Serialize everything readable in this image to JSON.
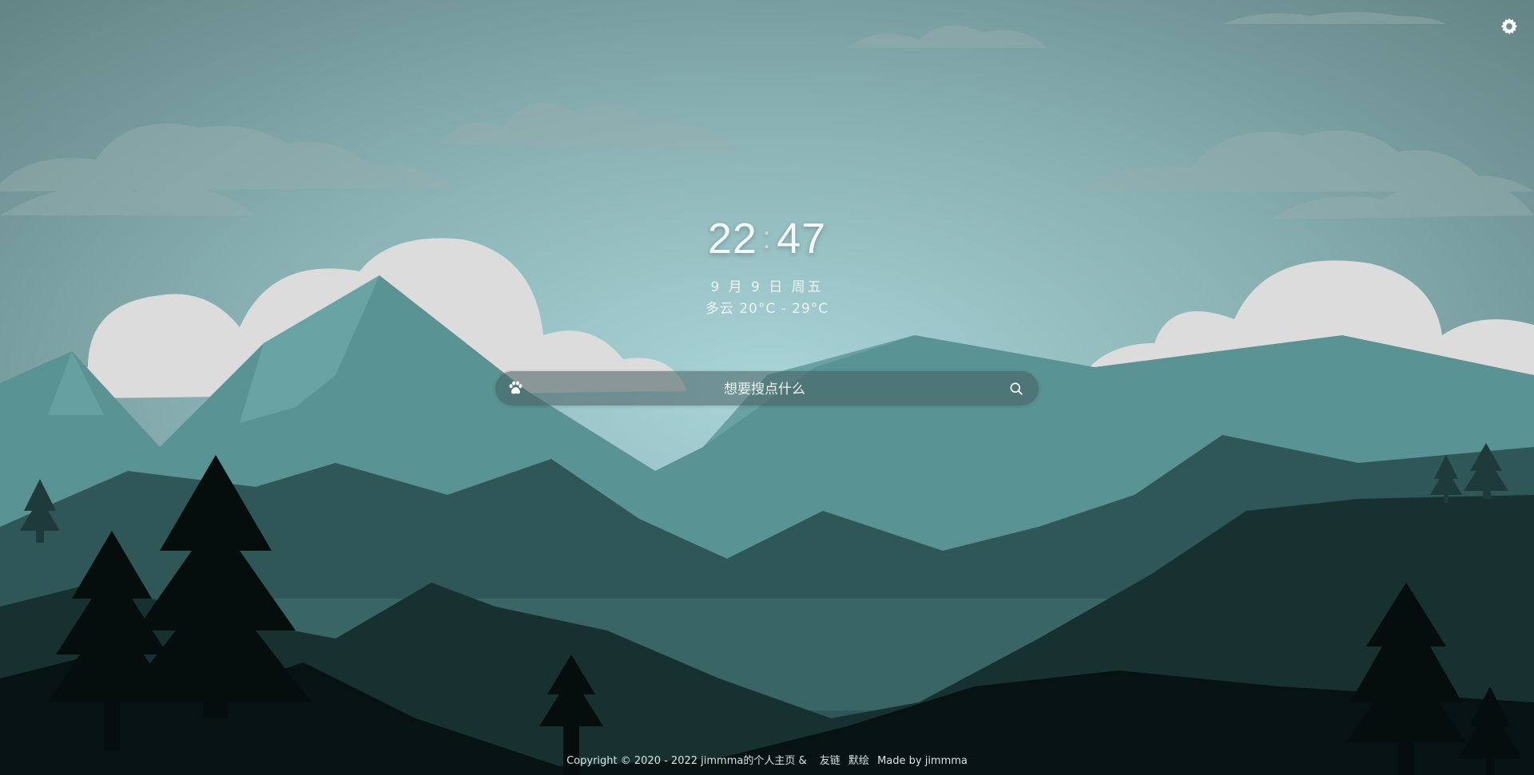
{
  "clock": {
    "hours": "22",
    "separator": ":",
    "minutes": "47"
  },
  "date_text": "9 月 9 日 周五",
  "weather_text": "多云 20°C - 29°C",
  "search": {
    "placeholder": "想要搜点什么",
    "engine_icon": "paw-icon",
    "submit_icon": "search-icon"
  },
  "settings_icon": "gear-icon",
  "footer": {
    "copyright": "Copyright © 2020 - 2022 jimmma的个人主页 &",
    "friends_link": "友链",
    "cloud_link": "默绘",
    "made_by": "Made by jimmma"
  },
  "colors": {
    "sky_top": "#6a8c8c",
    "sky_glow": "#a9d4d8",
    "cloud": "#e0e0e0",
    "mountain_far": "#5a9393",
    "mountain_mid": "#2f5757",
    "hills_dark": "#0f2323",
    "foreground": "#071212"
  }
}
